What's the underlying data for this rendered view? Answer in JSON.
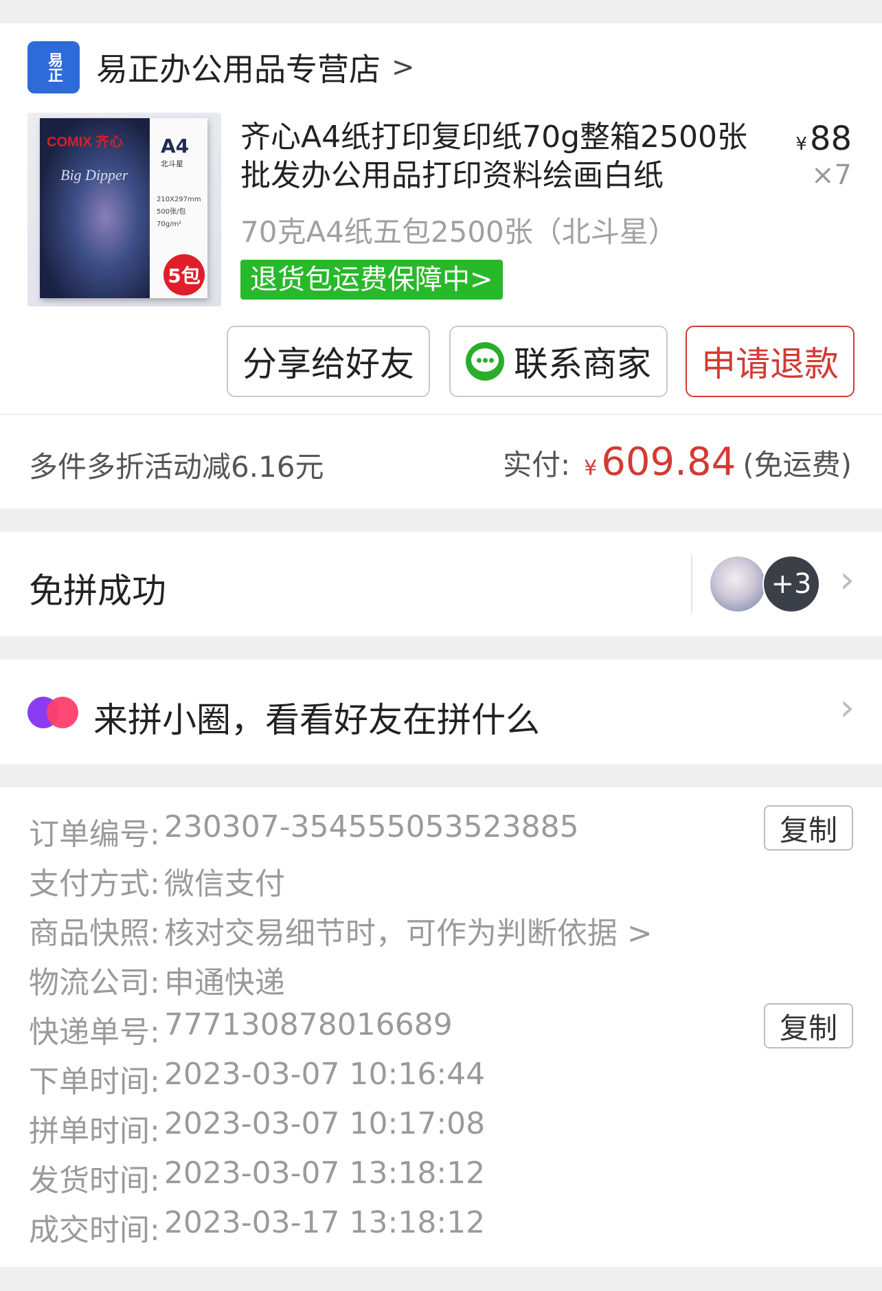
{
  "shop": {
    "logo_text": "易正",
    "name": "易正办公用品专营店",
    "chevron": ">"
  },
  "product": {
    "image_brand": "COMIX 齐心",
    "image_series": "Big Dipper",
    "image_size": "A4",
    "image_side": "北斗星",
    "image_spec": [
      "210X297mm",
      "500张/包",
      "70g/m²"
    ],
    "image_badge": "5包",
    "title": "齐心A4纸打印复印纸70g整箱2500张批发办公用品打印资料绘画白纸",
    "currency": "¥",
    "price": "88",
    "quantity": "×7",
    "spec": "70克A4纸五包2500张（北斗星）",
    "return_tag": "退货包运费保障中>"
  },
  "actions": {
    "share": "分享给好友",
    "contact": "联系商家",
    "refund": "申请退款"
  },
  "totals": {
    "discount": "多件多折活动减6.16元",
    "paid_label": "实付:",
    "currency": "¥",
    "paid_amount": "609.84",
    "shipping_note": "(免运费)"
  },
  "group": {
    "title": "免拼成功",
    "extra_count": "+3"
  },
  "circle": {
    "text": "来拼小圈，看看好友在拼什么"
  },
  "order_info": {
    "copy_label": "复制",
    "rows": [
      {
        "label": "订单编号:",
        "value": "230307-354555053523885"
      },
      {
        "label": "支付方式:",
        "value": "微信支付"
      },
      {
        "label": "商品快照:",
        "value": "核对交易细节时，可作为判断依据 >"
      },
      {
        "label": "物流公司:",
        "value": "申通快递"
      },
      {
        "label": "快递单号:",
        "value": "777130878016689"
      },
      {
        "label": "下单时间:",
        "value": "2023-03-07 10:16:44"
      },
      {
        "label": "拼单时间:",
        "value": "2023-03-07 10:17:08"
      },
      {
        "label": "发货时间:",
        "value": "2023-03-07 13:18:12"
      },
      {
        "label": "成交时间:",
        "value": "2023-03-17 13:18:12"
      }
    ]
  },
  "colors": {
    "accent_red": "#d33a33",
    "tag_green": "#28b92a",
    "shop_blue": "#2d6bd8"
  }
}
